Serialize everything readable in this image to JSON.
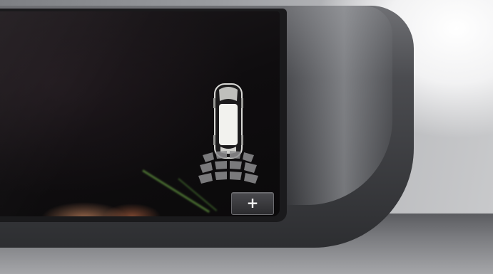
{
  "display": {
    "plus_button_label": "+"
  },
  "icons": {
    "car": "car-top-view-icon",
    "sensors": "parking-sensor-arcs-icon",
    "plus": "plus-icon"
  },
  "colors": {
    "screen_background": "#0f0d0f",
    "car_body": "#f2f2ee",
    "sensor_arcs": "#8e8e90",
    "bezel": "#3a3b3e"
  }
}
